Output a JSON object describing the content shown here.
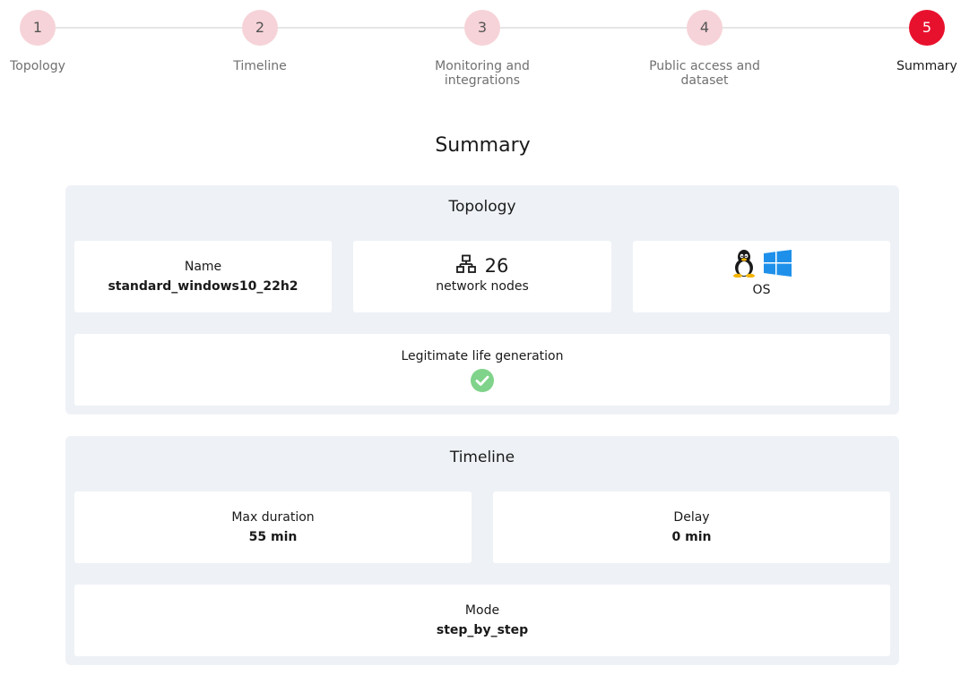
{
  "stepper": {
    "steps": [
      {
        "number": "1",
        "label": "Topology"
      },
      {
        "number": "2",
        "label": "Timeline"
      },
      {
        "number": "3",
        "label": "Monitoring and integrations"
      },
      {
        "number": "4",
        "label": "Public access and dataset"
      },
      {
        "number": "5",
        "label": "Summary"
      }
    ],
    "active_step": 5
  },
  "page_title": "Summary",
  "topology": {
    "title": "Topology",
    "name_label": "Name",
    "name_value": "standard_windows10_22h2",
    "nodes_icon": "network-icon",
    "nodes_count": "26",
    "nodes_label": "network nodes",
    "os_icons": [
      "linux-tux-icon",
      "windows-logo-icon"
    ],
    "os_label": "OS",
    "life_label": "Legitimate life generation",
    "life_icon": "check-circle-icon"
  },
  "timeline": {
    "title": "Timeline",
    "max_duration_label": "Max duration",
    "max_duration_value": "55 min",
    "delay_label": "Delay",
    "delay_value": "0 min",
    "mode_label": "Mode",
    "mode_value": "step_by_step"
  },
  "colors": {
    "accent": "#e8112d",
    "step_inactive": "#f6d3d8",
    "section_bg": "#eef2f6",
    "check_green": "#7fd38a",
    "windows_blue": "#1e90ea"
  }
}
